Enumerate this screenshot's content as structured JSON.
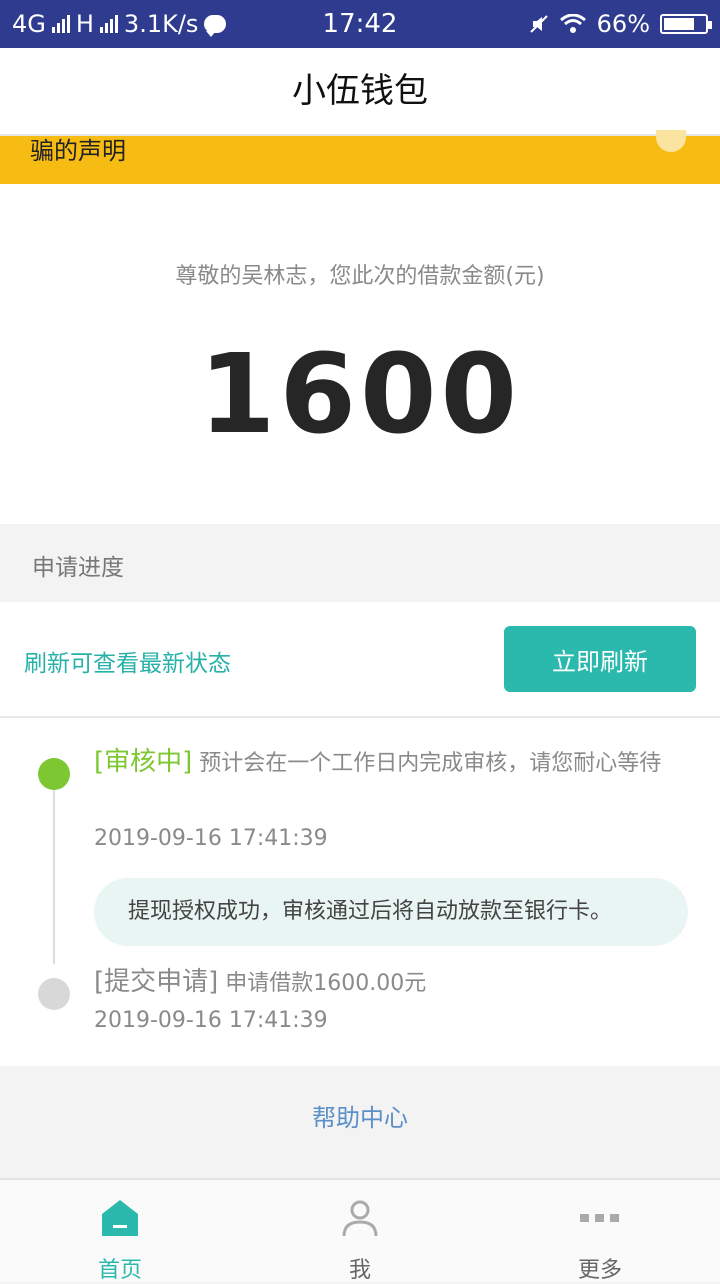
{
  "status_bar": {
    "network_4g": "4G",
    "network_h": "H",
    "speed": "3.1K/s",
    "time": "17:42",
    "battery": "66%"
  },
  "app_title": "小伍钱包",
  "notice": {
    "text": "骗的声明"
  },
  "loan": {
    "greeting": "尊敬的吴林志，您此次的借款金额(元)",
    "amount": "1600"
  },
  "progress": {
    "section_title": "申请进度",
    "refresh_tip": "刷新可查看最新状态",
    "refresh_button": "立即刷新",
    "items": [
      {
        "tag": "[审核中]",
        "text": "预计会在一个工作日内完成审核，请您耐心等待",
        "time": "2019-09-16 17:41:39",
        "note": "提现授权成功，审核通过后将自动放款至银行卡。"
      },
      {
        "tag": "[提交申请]",
        "text": "申请借款1600.00元",
        "time": "2019-09-16 17:41:39"
      }
    ]
  },
  "help_center": "帮助中心",
  "tabs": [
    {
      "label": "首页",
      "icon": "home-icon",
      "active": true
    },
    {
      "label": "我",
      "icon": "person-icon",
      "active": false
    },
    {
      "label": "更多",
      "icon": "more-icon",
      "active": false
    }
  ],
  "colors": {
    "status_bar": "#2e3b8f",
    "notice": "#f7bc14",
    "accent": "#2bb9ad",
    "reviewing": "#7dc832",
    "link": "#5b8fc7"
  }
}
